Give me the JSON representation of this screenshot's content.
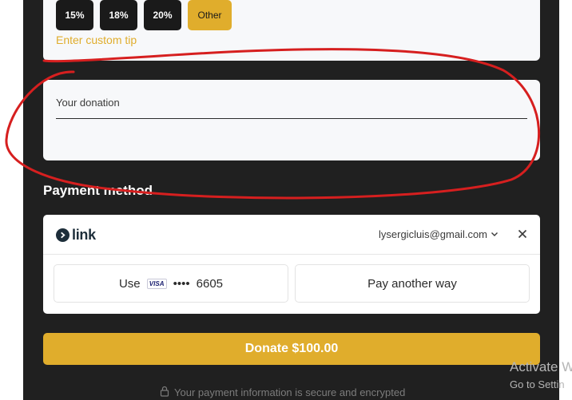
{
  "tips": {
    "options": [
      "15%",
      "18%",
      "20%"
    ],
    "other_label": "Other",
    "custom_placeholder": "Enter custom tip"
  },
  "donation": {
    "label": "Your donation",
    "value": ""
  },
  "payment": {
    "title": "Payment method",
    "link_word": "link",
    "email": "lysergicluis@gmail.com",
    "use_label": "Use",
    "card_brand": "VISA",
    "card_dots": "••••",
    "card_last4": "6605",
    "another_way_label": "Pay another way"
  },
  "donate_button_label": "Donate $100.00",
  "secure_text": "Your payment information is secure and encrypted",
  "watermark": {
    "line1": "Activate W",
    "line2": "Go to Settin"
  },
  "colors": {
    "accent": "#e0ad2c",
    "panel": "#202020",
    "annotation": "#d61f1f"
  }
}
